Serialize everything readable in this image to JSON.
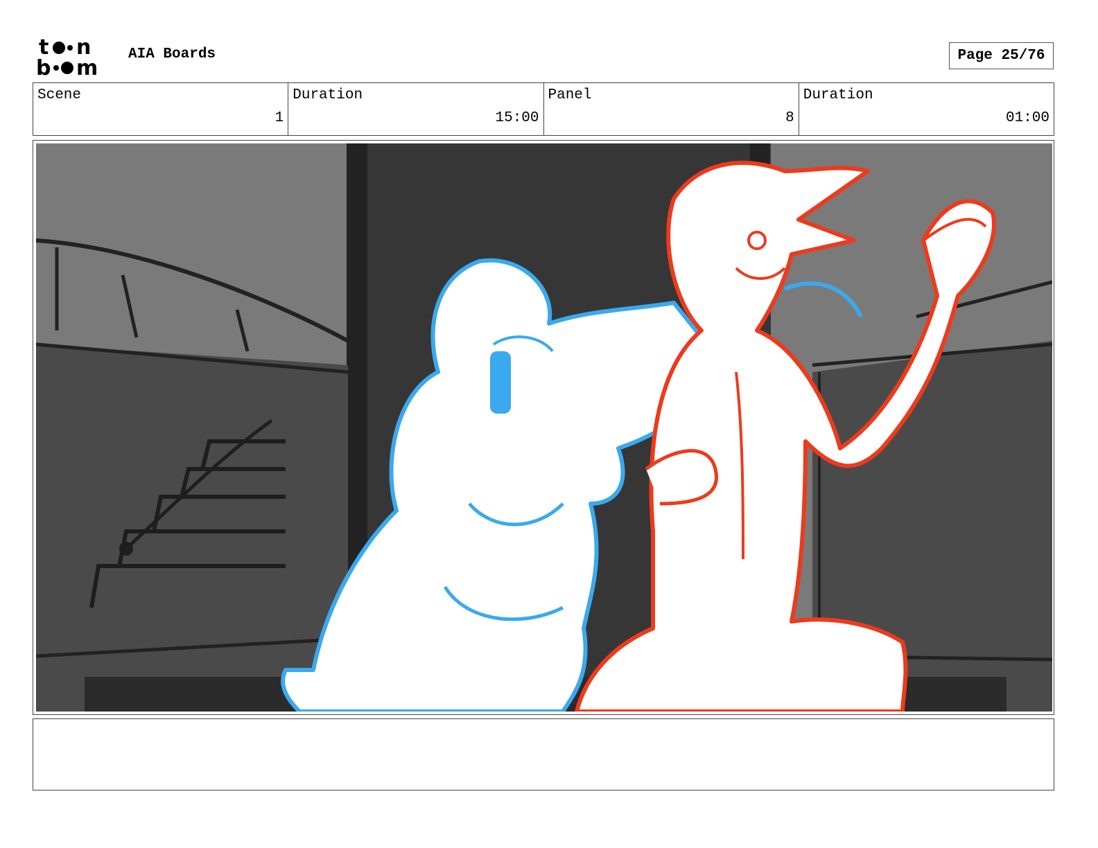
{
  "header": {
    "logo_text": "toon boom",
    "project_title": "AIA Boards",
    "page_label": "Page 25/76"
  },
  "info": {
    "scene_label": "Scene",
    "scene_value": "1",
    "scene_duration_label": "Duration",
    "scene_duration_value": "15:00",
    "panel_label": "Panel",
    "panel_value": "8",
    "panel_duration_label": "Duration",
    "panel_duration_value": "01:00"
  },
  "colors": {
    "woman_line": "#3aa9ee",
    "man_line": "#ee3a1c",
    "background_dark": "#3a3a3a",
    "background_mid": "#7a7a7a"
  }
}
